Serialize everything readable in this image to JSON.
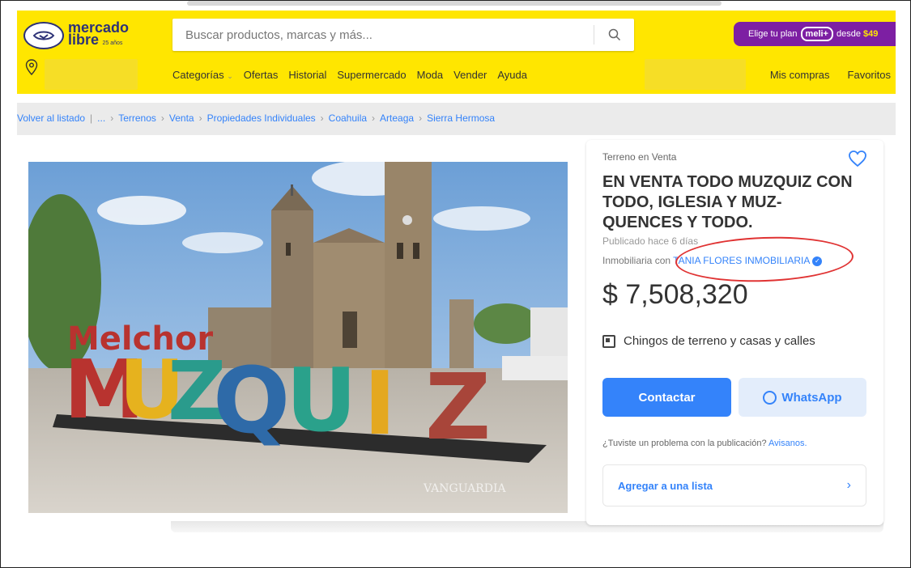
{
  "header": {
    "logo_word1": "mercado",
    "logo_word2": "libre",
    "logo_years": "25 años",
    "search_placeholder": "Buscar productos, marcas y más...",
    "promo": {
      "prefix": "Elige tu plan",
      "brand": "meli+",
      "suffix": "desde",
      "price": "$49"
    },
    "nav_items": [
      "Categorías",
      "Ofertas",
      "Historial",
      "Supermercado",
      "Moda",
      "Vender",
      "Ayuda"
    ],
    "nav_right": [
      "Mis compras",
      "Favoritos"
    ]
  },
  "breadcrumb": {
    "back": "Volver al listado",
    "items": [
      "...",
      "Terrenos",
      "Venta",
      "Propiedades Individuales",
      "Coahuila",
      "Arteaga",
      "Sierra Hermosa"
    ]
  },
  "listing": {
    "condition": "Terreno en Venta",
    "title": "EN VENTA TODO MUZQUIZ CON TODO, IGLESIA Y MUZ-QUENCES Y TODO.",
    "published": "Publicado hace 6 días",
    "seller_prefix": "Inmobiliaria con",
    "seller_name": "TANIA FLORES INMOBILIARIA",
    "price": "$ 7,508,320",
    "feature": "Chingos de terreno y casas y calles",
    "contact_label": "Contactar",
    "whatsapp_label": "WhatsApp",
    "problem_text": "¿Tuviste un problema con la publicación?",
    "problem_link": "Avisanos.",
    "add_list_label": "Agregar a una lista"
  },
  "image": {
    "sign_top": "Melchor",
    "sign_letters": [
      "M",
      "U",
      "Z",
      "Q",
      "U",
      "I",
      "Z"
    ],
    "watermark": "VANGUARDIA"
  },
  "colors": {
    "brand_yellow": "#ffe600",
    "accent_blue": "#3483fa",
    "highlight_red": "#e03333",
    "promo_purple": "#7d1fa3"
  }
}
